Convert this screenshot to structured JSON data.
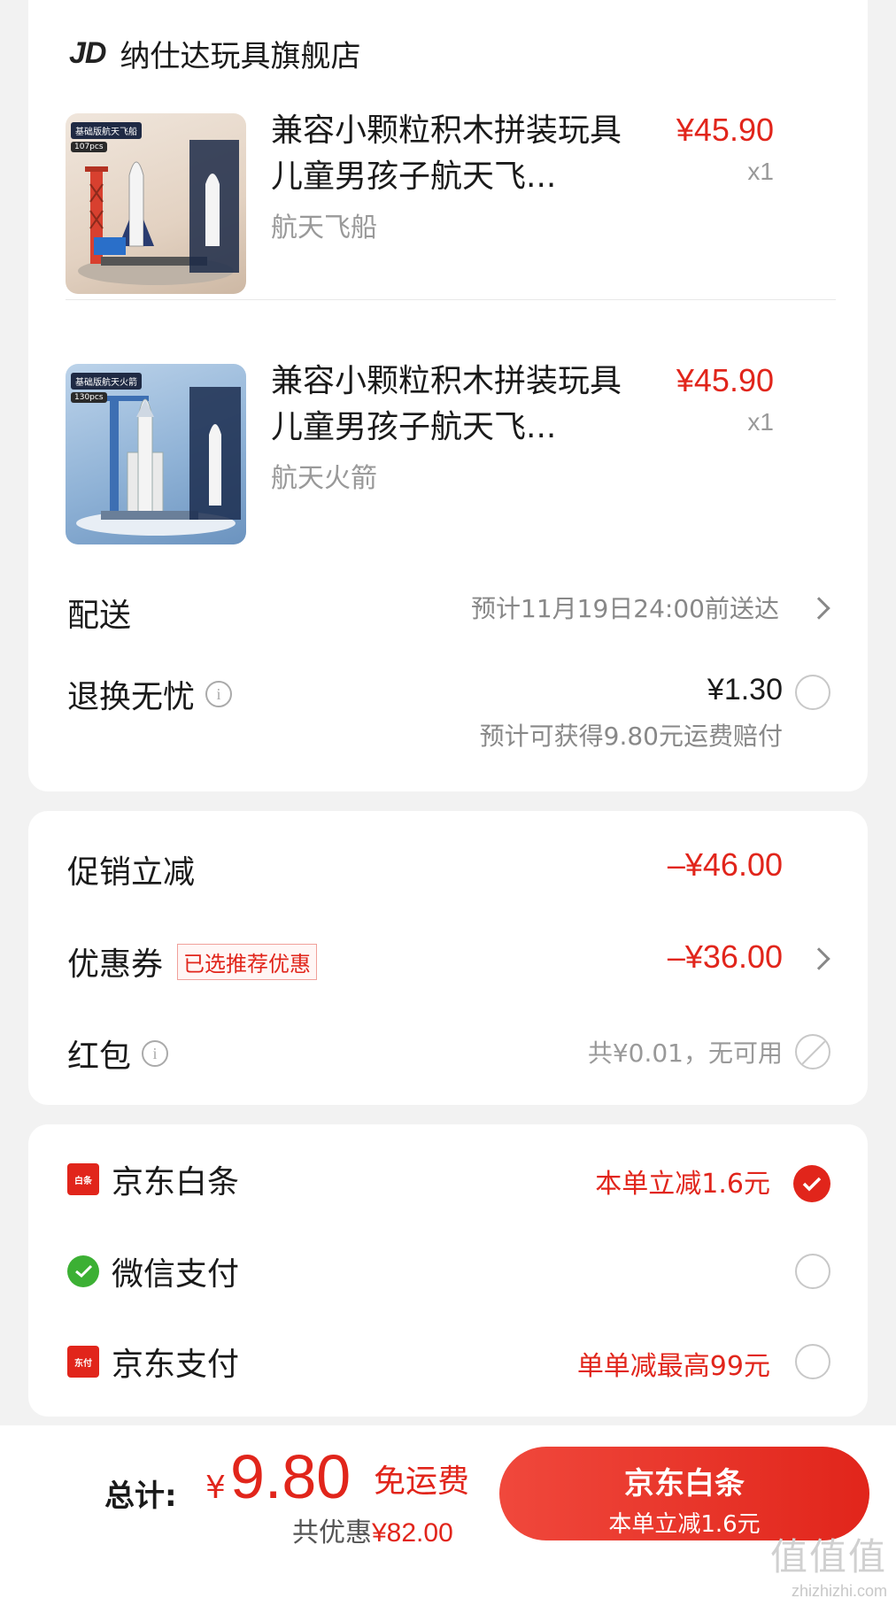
{
  "store": {
    "logo": "JD",
    "name": "纳仕达玩具旗舰店"
  },
  "products": [
    {
      "title": "兼容小颗粒积木拼装玩具儿童男孩子航天飞...",
      "variant": "航天飞船",
      "price": "¥45.90",
      "qty": "x1",
      "thumb_tag": "基础版航天飞船",
      "thumb_pcs": "107pcs"
    },
    {
      "title": "兼容小颗粒积木拼装玩具儿童男孩子航天飞...",
      "variant": "航天火箭",
      "price": "¥45.90",
      "qty": "x1",
      "thumb_tag": "基础版航天火箭",
      "thumb_pcs": "130pcs"
    }
  ],
  "delivery": {
    "label": "配送",
    "value": "预计11月19日24:00前送达"
  },
  "return_insurance": {
    "label": "退换无忧",
    "price": "¥1.30",
    "note": "预计可获得9.80元运费赔付"
  },
  "discounts": {
    "promo_label": "促销立减",
    "promo_value": "–¥46.00",
    "coupon_label": "优惠券",
    "coupon_tag": "已选推荐优惠",
    "coupon_value": "–¥36.00",
    "redpacket_label": "红包",
    "redpacket_value": "共¥0.01，无可用"
  },
  "payment_methods": [
    {
      "name": "京东白条",
      "promo": "本单立减1.6元",
      "selected": true,
      "icon": "baitiao-icon",
      "icon_text": "白条"
    },
    {
      "name": "微信支付",
      "promo": "",
      "selected": false,
      "icon": "wechat-pay-icon",
      "icon_text": ""
    },
    {
      "name": "京东支付",
      "promo": "单单减最高99元",
      "selected": false,
      "icon": "jd-pay-icon",
      "icon_text": "东付"
    }
  ],
  "footer": {
    "total_label": "总计:",
    "currency": "¥",
    "total": "9.80",
    "free_shipping": "免运费",
    "savings_label": "共优惠",
    "savings_amount": "¥82.00",
    "button_title": "京东白条",
    "button_sub": "本单立减1.6元"
  },
  "watermark": {
    "big": "值值值",
    "small": "zhizhizhi.com"
  },
  "colors": {
    "accent": "#e1251b",
    "muted": "#999999"
  }
}
